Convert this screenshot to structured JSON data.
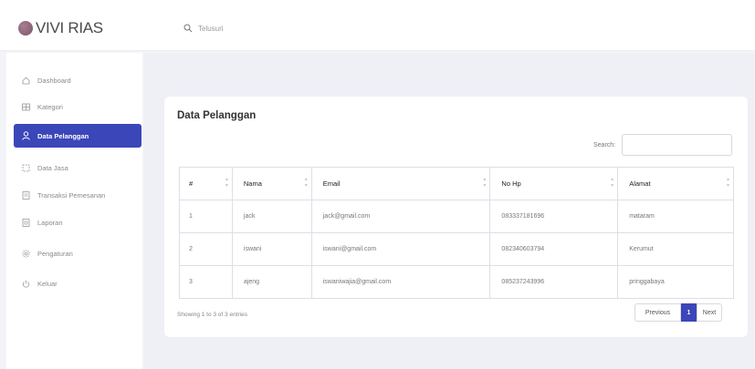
{
  "brand": {
    "name": "VIVI RIAS",
    "logo_color": "#8c6479"
  },
  "topbar": {
    "search_placeholder": "Telusuri",
    "search_icon": "search-icon"
  },
  "sidebar": {
    "active_color": "#3b46b9",
    "items": [
      {
        "label": "Dashboard",
        "icon": "home-icon",
        "active": false
      },
      {
        "label": "Kategori",
        "icon": "grid-icon",
        "active": false
      },
      {
        "label": "Data Pelanggan",
        "icon": "user-icon",
        "active": true
      },
      {
        "label": "Data Jasa",
        "icon": "box-icon",
        "active": false
      },
      {
        "label": "Transaksi Pemesanan",
        "icon": "receipt-icon",
        "active": false
      },
      {
        "label": "Laporan",
        "icon": "report-icon",
        "active": false
      },
      {
        "label": "Pengaturan",
        "icon": "gear-icon",
        "active": false
      },
      {
        "label": "Keluar",
        "icon": "power-icon",
        "active": false
      }
    ]
  },
  "card": {
    "title": "Data Pelanggan",
    "search_label": "Search:",
    "search_value": ""
  },
  "table": {
    "columns": [
      "#",
      "Nama",
      "Email",
      "No Hp",
      "Alamat"
    ],
    "rows": [
      [
        "1",
        "jack",
        "jack@gmail.com",
        "083337181696",
        "mataram"
      ],
      [
        "2",
        "iswani",
        "iswani@gmail.com",
        "082340603794",
        "Kerumut"
      ],
      [
        "3",
        "ajeng",
        "iswaniwajia@gmail.com",
        "085237243996",
        "pringgabaya"
      ]
    ]
  },
  "footer": {
    "entries_text": "Showing 1 to 3 of 3 entries",
    "prev_label": "Previous",
    "current_page": "1",
    "next_label": "Next"
  }
}
